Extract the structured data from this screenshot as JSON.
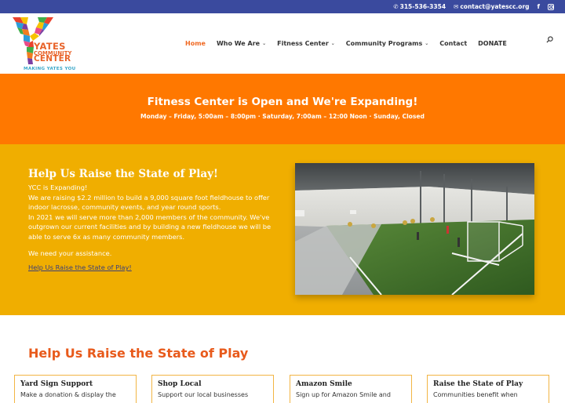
{
  "topbar": {
    "phone": "315-536-3354",
    "email": "contact@yatescc.org",
    "social": [
      "facebook",
      "instagram"
    ]
  },
  "logo": {
    "line1": "YATES",
    "line2": "COMMUNITY",
    "line3": "CENTER",
    "tagline": "MAKING YATES YOU"
  },
  "nav": {
    "items": [
      {
        "label": "Home",
        "active": true,
        "dropdown": false
      },
      {
        "label": "Who We Are",
        "dropdown": true
      },
      {
        "label": "Fitness Center",
        "dropdown": true
      },
      {
        "label": "Community Programs",
        "dropdown": true
      },
      {
        "label": "Contact",
        "dropdown": false
      },
      {
        "label": "DONATE",
        "dropdown": false
      }
    ],
    "chevron": "⌄"
  },
  "banner": {
    "title": "Fitness Center is Open and We're Expanding!",
    "hours": "Monday – Friday, 5:00am – 8:00pm · Saturday, 7:00am – 12:00 Noon · Sunday, Closed"
  },
  "feature": {
    "title": "Help Us Raise the State of Play!",
    "line1": "YCC is Expanding!",
    "para1": "We are raising $2.2 million to build a 9,000 square foot fieldhouse to offer indoor lacrosse, community events, and year round sports.",
    "para2": "In 2021 we will serve more than 2,000 members of the community. We've outgrown our current facilities and by building a new fieldhouse we will be able to serve 6x as many community members.",
    "need": "We need your assistance.",
    "link": "Help Us Raise the State of Play!"
  },
  "section": {
    "title": "Help Us Raise the State of Play"
  },
  "cards": [
    {
      "title": "Yard Sign Support",
      "text": "Make a donation & display the"
    },
    {
      "title": "Shop Local",
      "text": "Support our local businesses"
    },
    {
      "title": "Amazon Smile",
      "text": "Sign up for Amazon Smile and"
    },
    {
      "title": "Raise the State of Play",
      "text": "Communities benefit when"
    }
  ],
  "colors": {
    "topbar": "#3a4a9e",
    "orange": "#ff7800",
    "gold": "#f0ae00",
    "accent": "#e85a1b"
  }
}
